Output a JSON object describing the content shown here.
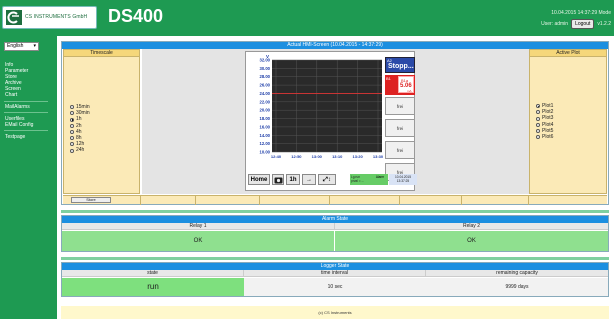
{
  "header": {
    "logo_text": "CS INSTRUMENTS GmbH",
    "title": "DS400",
    "datetime": "10.04.2015 14:37:29 Mode",
    "user_label": "User: admin",
    "logout_label": "Logout",
    "version": "v1.2.2"
  },
  "sidebar": {
    "language": "English",
    "group1": [
      "Info",
      "Parameter",
      "Store",
      "Archive",
      "Screen",
      "Chart"
    ],
    "group2": [
      "MailAlarms"
    ],
    "group3": [
      "Userfiles",
      "EMail Config"
    ],
    "group4": [
      "Testpage"
    ]
  },
  "hmi": {
    "title": "Actual HMI-Screen (10.04.2015 - 14:37:29)",
    "timescale_label": "Timescale",
    "timescale_options": [
      "15min",
      "30min",
      "1h",
      "2h",
      "4h",
      "8h",
      "12h",
      "24h"
    ],
    "timescale_selected": 2,
    "active_plot_label": "Active Plot",
    "plot_options": [
      "Plot1",
      "Plot2",
      "Plot3",
      "Plot4",
      "Plot5",
      "Plot6"
    ],
    "plot_selected": 0,
    "store_label": "Store",
    "screen": {
      "unit": "V",
      "stop_a2": "A2",
      "stop_text": "Stopp...",
      "b1_label": "B1",
      "b1_channel": "B1a",
      "b1_value": "5.06",
      "b1_unit": "mA",
      "free_labels": [
        "frei",
        "frei",
        "frei",
        "frei"
      ],
      "home_label": "Home",
      "btn_1h": "1h",
      "alarm_label": "Alarm",
      "lgrun_label": "Lg.run",
      "interval_label": "prval = ...",
      "date_label": "10.04.2015",
      "time_label": "13:37:25"
    }
  },
  "chart_data": {
    "type": "line",
    "ylabel": "V",
    "y_ticks": [
      "32.00",
      "30.00",
      "28.00",
      "26.00",
      "24.00",
      "22.00",
      "20.00",
      "18.00",
      "16.00",
      "14.00",
      "12.00",
      "10.00"
    ],
    "x_ticks": [
      "12:40",
      "12:50",
      "13:00",
      "13:10",
      "13:20",
      "13:30"
    ],
    "ylim": [
      10,
      32
    ],
    "series": [
      {
        "values": [
          24,
          24,
          24,
          24,
          24,
          24
        ]
      }
    ]
  },
  "alarm": {
    "title": "Alarm State",
    "relays": [
      {
        "name": "Relay 1",
        "state": "OK"
      },
      {
        "name": "Relay 2",
        "state": "OK"
      }
    ]
  },
  "logger": {
    "title": "Logger State",
    "columns": [
      "state",
      "time interval",
      "remaining capacity"
    ],
    "values": [
      "run",
      "10 sec",
      "9999 days"
    ]
  },
  "footer": "(c) CS Instruments",
  "colors": {
    "brand_green": "#1e9a52",
    "accent_blue": "#1c8fe0",
    "ok_green": "#8fe08f"
  }
}
